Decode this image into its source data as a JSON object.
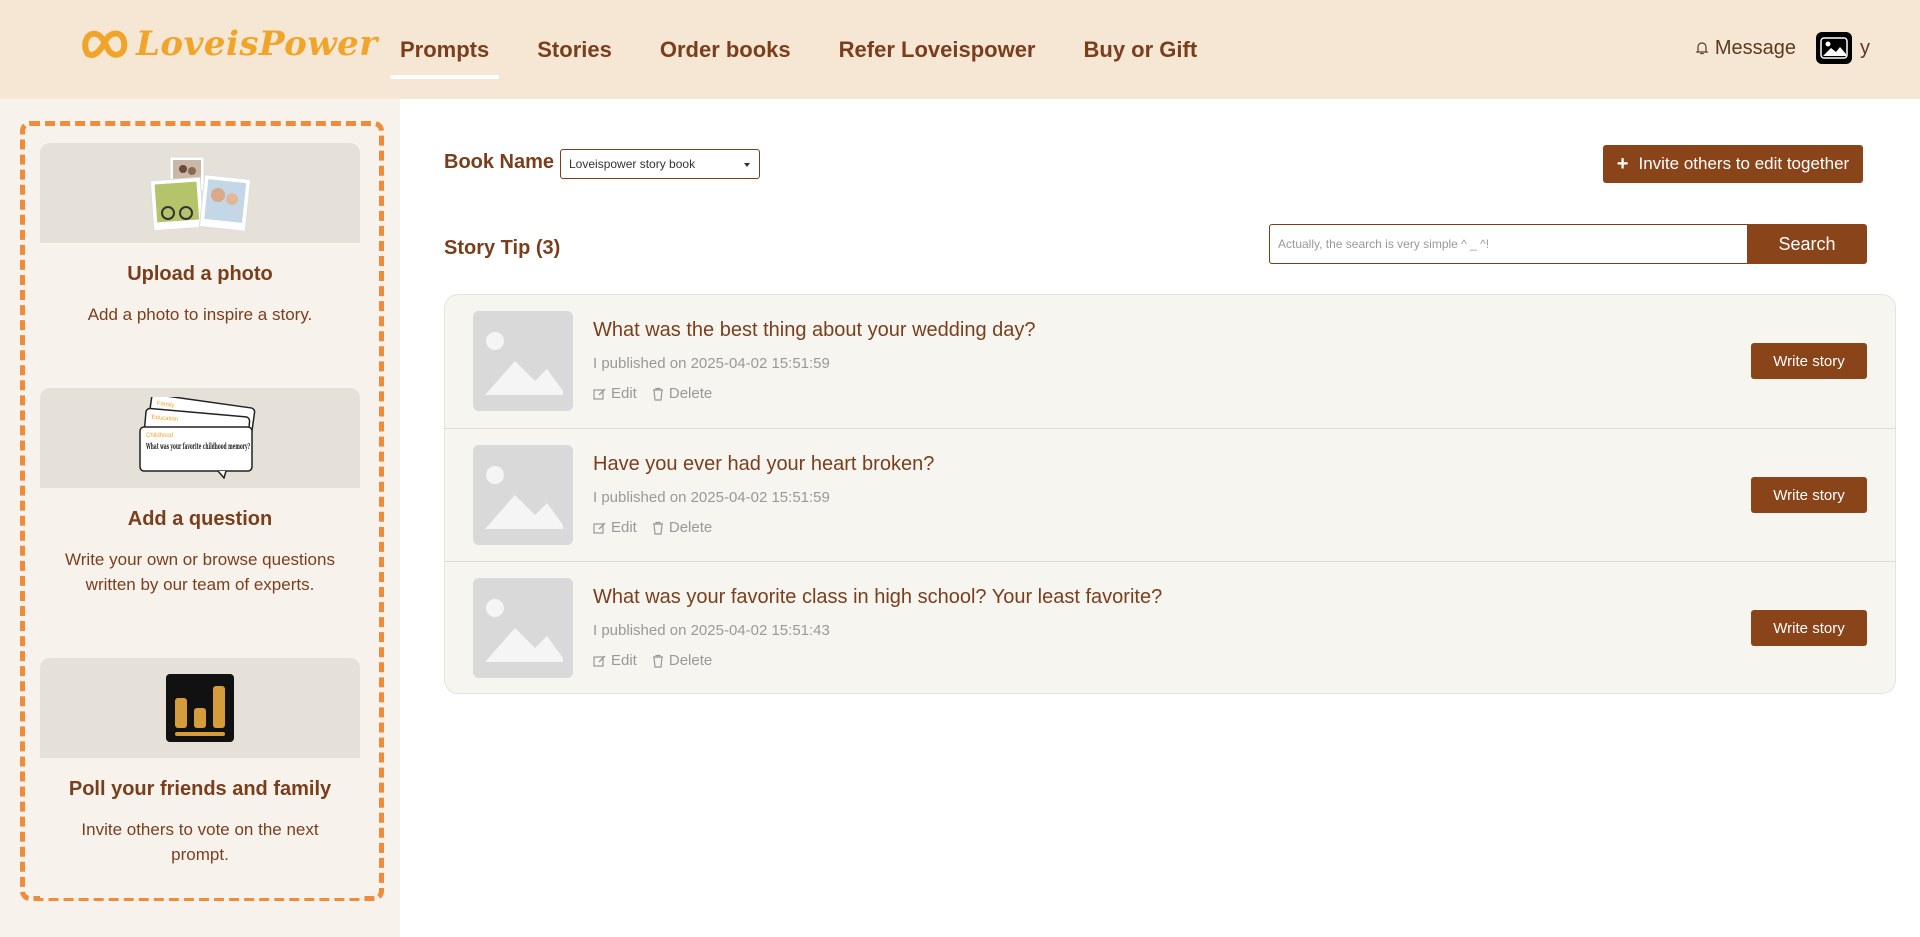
{
  "brand": {
    "name": "LoveisPower"
  },
  "nav": {
    "items": [
      {
        "label": "Prompts",
        "active": true
      },
      {
        "label": "Stories"
      },
      {
        "label": "Order books"
      },
      {
        "label": "Refer Loveispower"
      },
      {
        "label": "Buy or Gift"
      }
    ]
  },
  "header": {
    "message_label": "Message",
    "username": "y"
  },
  "sidebar": {
    "cards": [
      {
        "title": "Upload a photo",
        "desc": "Add a photo to inspire a story.",
        "icon": "photo-collage-icon"
      },
      {
        "title": "Add a question",
        "desc": "Write your own or browse questions written by our team of experts.",
        "icon": "question-cards-icon",
        "illustration": {
          "tag1": "Family",
          "tag2": "Education",
          "tag3": "Childhood",
          "question": "What was your favorite childhood memory?"
        }
      },
      {
        "title": "Poll your friends and family",
        "desc": "Invite others to vote on the next prompt.",
        "icon": "bar-chart-icon"
      }
    ]
  },
  "main": {
    "book_label": "Book Name",
    "book_selected": "Loveispower story book",
    "invite_label": "Invite others to edit together",
    "tip_label": "Story Tip (3)",
    "search_placeholder": "Actually, the search is very simple ^ _ ^!",
    "search_label": "Search",
    "prompts": [
      {
        "title": "What was the best thing about your wedding day?",
        "date": "I published on 2025-04-02 15:51:59",
        "edit": "Edit",
        "delete": "Delete",
        "write": "Write story"
      },
      {
        "title": "Have you ever had your heart broken?",
        "date": "I published on 2025-04-02 15:51:59",
        "edit": "Edit",
        "delete": "Delete",
        "write": "Write story"
      },
      {
        "title": "What was your favorite class in high school? Your least favorite?",
        "date": "I published on 2025-04-02 15:51:43",
        "edit": "Edit",
        "delete": "Delete",
        "write": "Write story"
      }
    ]
  },
  "colors": {
    "header_bg": "#f5e7d4",
    "accent": "#8a4419",
    "logo": "#f1a42a",
    "dashed_border": "#ef8c3a",
    "text": "#7a3e1d"
  }
}
